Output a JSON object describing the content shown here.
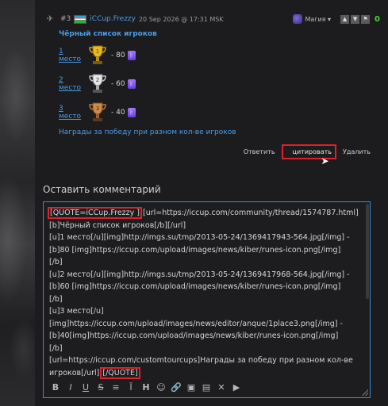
{
  "post": {
    "number": "#3",
    "username": "iCCup.Frezzy",
    "date": "20 Sep 2026 @ 17:31 MSK",
    "magic_label": "Магия ▾",
    "score": "0",
    "blacklist_title": "Чёрный список игроков",
    "places": [
      {
        "label": "1 место",
        "value": "- 80",
        "trophy": "gold"
      },
      {
        "label": "2 место",
        "value": "- 60",
        "trophy": "silver"
      },
      {
        "label": "3 место",
        "value": "- 40",
        "trophy": "bronze"
      }
    ],
    "prize_link": "Награды за победу при разном кол-ве игроков",
    "actions": {
      "reply": "Ответить",
      "quote": "цитировать",
      "delete": "Удалить"
    }
  },
  "comment": {
    "heading": "Оставить комментарий",
    "quote_open": "[QUOTE=iCCup.Frezzy ]",
    "body": "[url=https://iccup.com/community/thread/1574787.html]\n[b]Чёрный список игроков[/b][/url]\n[u]1 место[/u][img]http://imgs.su/tmp/2013-05-24/1369417943-564.jpg[/img] -\n[b]80 [img]https://iccup.com/upload/images/news/kiber/runes-icon.png[/img]\n[/b]\n[u]2 место[/u][img]http://imgs.su/tmp/2013-05-24/1369417968-564.jpg[/img] -\n[b]60 [img]https://iccup.com/upload/images/news/kiber/runes-icon.png[/img]\n[/b]\n[u]3 место[/u]\n[img]https://iccup.com/upload/images/news/editor/anque/1place3.png[/img] -\n[b]40[img]https://iccup.com/upload/images/news/kiber/runes-icon.png[/img]\n[/b]\n[url=https://iccup.com/customtourcups]Награды за победу при разном кол-ве\nигроков[/url] ",
    "quote_close": "[/QUOTE]"
  },
  "toolbar": [
    {
      "name": "bold-icon",
      "glyph": "B"
    },
    {
      "name": "italic-icon",
      "glyph": "I"
    },
    {
      "name": "underline-icon",
      "glyph": "U"
    },
    {
      "name": "strikethrough-icon",
      "glyph": "S"
    },
    {
      "name": "align-center-icon",
      "glyph": "≡"
    },
    {
      "name": "hr-icon",
      "glyph": "Ī"
    },
    {
      "name": "heading-icon",
      "glyph": "H"
    },
    {
      "name": "emoji-icon",
      "glyph": "☺"
    },
    {
      "name": "link-icon",
      "glyph": "🔗"
    },
    {
      "name": "image-icon",
      "glyph": "▣"
    },
    {
      "name": "media-icon",
      "glyph": "▤"
    },
    {
      "name": "collapse-icon",
      "glyph": "✕"
    },
    {
      "name": "youtube-icon",
      "glyph": "▶"
    }
  ],
  "colors": {
    "link": "#4a9be8",
    "highlight": "#e0202a",
    "score": "#4cd13a",
    "editor_border": "#3b8cd6"
  }
}
